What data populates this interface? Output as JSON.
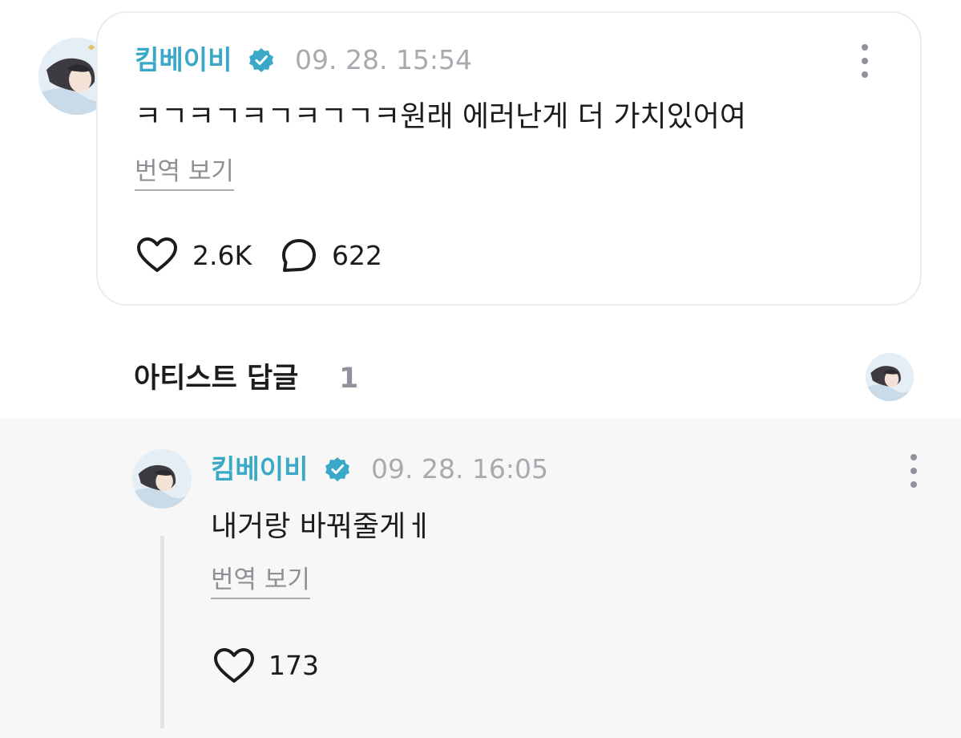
{
  "comment": {
    "author": "킴베이비",
    "timestamp": "09. 28. 15:54",
    "text": "ㅋㄱㅋㄱㅋㄱㅋㄱㄱㅋ원래 에러난게 더 가치있어여",
    "translate_label": "번역 보기",
    "likes": "2.6K",
    "replies": "622"
  },
  "artist_reply_section": {
    "title": "아티스트 답글",
    "count": "1"
  },
  "reply": {
    "author": "킴베이비",
    "timestamp": "09. 28. 16:05",
    "text": "내거랑 바꿔줄게ㅔ",
    "translate_label": "번역 보기",
    "likes": "173"
  },
  "colors": {
    "author": "#3aa9c7",
    "verified_badge": "#3aa9c7",
    "timestamp": "#a7abb0",
    "text": "#1c1c1c",
    "reply_background": "#f7f7f7"
  },
  "icons": {
    "verified": "verified-badge-icon",
    "like": "heart-icon",
    "reply": "speech-bubble-icon",
    "more": "more-vertical-icon"
  }
}
